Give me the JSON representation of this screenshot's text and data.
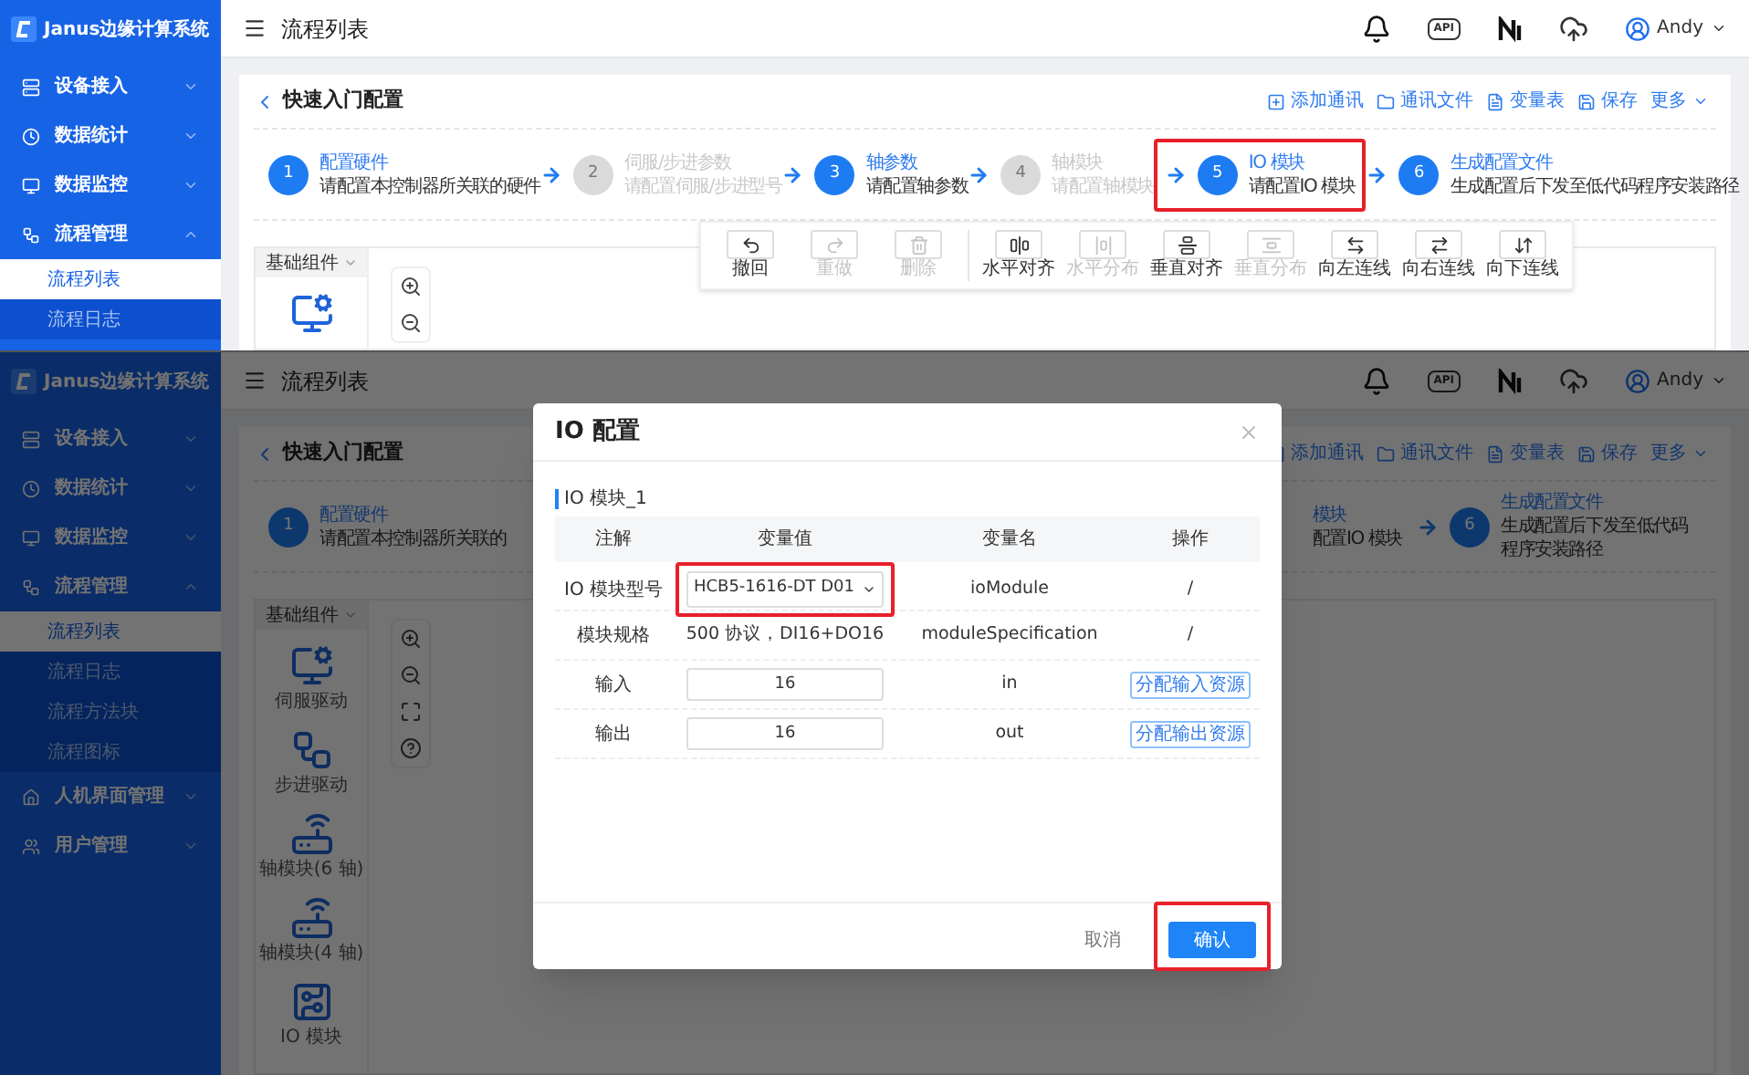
{
  "top_screen": {
    "header": {
      "app_name": "Janus边缘计算系统",
      "page_title": "流程列表",
      "api_label": "API",
      "user": "Andy"
    },
    "sidebar": [
      {
        "label": "设备接入",
        "expanded": false
      },
      {
        "label": "数据统计",
        "expanded": false
      },
      {
        "label": "数据监控",
        "expanded": false
      },
      {
        "label": "流程管理",
        "expanded": true,
        "children": [
          {
            "label": "流程列表",
            "selected": true
          },
          {
            "label": "流程日志",
            "selected": false
          }
        ]
      }
    ],
    "title": "快速入门配置",
    "actions": [
      "添加通讯",
      "通讯文件",
      "变量表",
      "保存",
      "更多"
    ],
    "step_groups": [
      [
        {
          "number": "1",
          "title": "配置硬件",
          "description": "请配置本控制器所关联的硬件",
          "enabled": true,
          "highlighted": false,
          "arrow": false
        },
        {
          "number": "2",
          "title": "伺服/步进参数",
          "description": "请配置伺服/步进型号",
          "enabled": false,
          "highlighted": false,
          "arrow": true
        },
        {
          "number": "3",
          "title": "轴参数",
          "description": "请配置轴参数",
          "enabled": true,
          "highlighted": false,
          "arrow": true
        },
        {
          "number": "4",
          "title": "轴模块",
          "description": "请配置轴模块",
          "enabled": false,
          "highlighted": false,
          "arrow": true
        },
        {
          "number": "5",
          "title": "IO 模块",
          "description": "请配置IO 模块",
          "enabled": true,
          "highlighted": true,
          "arrow": true
        },
        {
          "number": "6",
          "title": "生成配置文件",
          "description": "生成配置后下发至低代码程序安装路径",
          "enabled": true,
          "highlighted": false,
          "arrow": true
        }
      ]
    ],
    "toolbar": [
      [
        {
          "label": "撤回",
          "disabled": false
        },
        {
          "label": "重做",
          "disabled": true
        },
        {
          "label": "删除",
          "disabled": true
        }
      ],
      [
        {
          "label": "水平对齐",
          "disabled": false
        },
        {
          "label": "水平分布",
          "disabled": true
        },
        {
          "label": "垂直对齐",
          "disabled": false
        },
        {
          "label": "垂直分布",
          "disabled": true
        },
        {
          "label": "向左连线",
          "disabled": false
        },
        {
          "label": "向右连线",
          "disabled": false
        },
        {
          "label": "向下连线",
          "disabled": false
        }
      ]
    ],
    "palette_tab": "基础组件",
    "palette": [
      {
        "kind": "servo"
      }
    ],
    "zoom_tools": [
      {
        "kind": "zoom-in"
      },
      {
        "kind": "zoom-out"
      }
    ]
  },
  "bottom_screen": {
    "header": {
      "app_name": "Janus边缘计算系统",
      "page_title": "流程列表",
      "api_label": "API",
      "user": "Andy"
    },
    "sidebar": [
      {
        "label": "设备接入",
        "expanded": false
      },
      {
        "label": "数据统计",
        "expanded": false
      },
      {
        "label": "数据监控",
        "expanded": false
      },
      {
        "label": "流程管理",
        "expanded": true,
        "children": [
          {
            "label": "流程列表",
            "selected": true
          },
          {
            "label": "流程日志",
            "selected": false
          },
          {
            "label": "流程方法块",
            "selected": false
          },
          {
            "label": "流程图标",
            "selected": false
          }
        ]
      },
      {
        "label": "人机界面管理",
        "expanded": false
      },
      {
        "label": "用户管理",
        "expanded": false
      }
    ],
    "title": "快速入门配置",
    "actions": [
      "添加通讯",
      "通讯文件",
      "变量表",
      "保存",
      "更多"
    ],
    "step_groups": [
      [
        {
          "number": "1",
          "title": "配置硬件",
          "description": "请配置本控制器所关联的",
          "enabled": true,
          "highlighted": false,
          "arrow": false
        }
      ],
      [
        {
          "title": "模块",
          "description": "配置IO 模块",
          "enabled": true,
          "highlighted": false,
          "arrow": false
        },
        {
          "number": "6",
          "title": "生成配置文件",
          "description": "生成配置后下发至低代码程序安装路径",
          "enabled": true,
          "highlighted": false,
          "arrow": true
        }
      ]
    ],
    "palette_tab": "基础组件",
    "palette": [
      {
        "kind": "servo",
        "label": "伺服驱动"
      },
      {
        "kind": "stepper",
        "label": "步进驱动"
      },
      {
        "kind": "axis",
        "label": "轴模块(6 轴)"
      },
      {
        "kind": "axis",
        "label": "轴模块(4 轴)"
      },
      {
        "kind": "io",
        "label": "IO 模块"
      }
    ],
    "zoom_tools": [
      {
        "kind": "zoom-in"
      },
      {
        "kind": "zoom-out"
      },
      {
        "kind": "fit"
      },
      {
        "kind": "help"
      }
    ],
    "modal": {
      "title": "IO 配置",
      "section": "IO 模块_1",
      "columns": [
        "注解",
        "变量值",
        "变量名",
        "操作"
      ],
      "rows": [
        {
          "kind": "select",
          "note": "IO 模块型号",
          "value": "HCB5-1616-DT D01",
          "name": "ioModule",
          "action": {
            "kind": "text",
            "label": "/"
          },
          "highlighted": true
        },
        {
          "kind": "text",
          "note": "模块规格",
          "value": "500 协议，DI16+DO16",
          "name": "moduleSpecification",
          "action": {
            "kind": "text",
            "label": "/"
          },
          "highlighted": false
        },
        {
          "kind": "input",
          "note": "输入",
          "value": "16",
          "name": "in",
          "action": {
            "kind": "button",
            "label": "分配输入资源"
          },
          "highlighted": false
        },
        {
          "kind": "input",
          "note": "输出",
          "value": "16",
          "name": "out",
          "action": {
            "kind": "button",
            "label": "分配输出资源"
          },
          "highlighted": false
        }
      ],
      "buttons": [
        {
          "label": "取消",
          "kind": "text",
          "highlighted": false
        },
        {
          "label": "确认",
          "kind": "primary",
          "highlighted": true
        }
      ]
    }
  }
}
